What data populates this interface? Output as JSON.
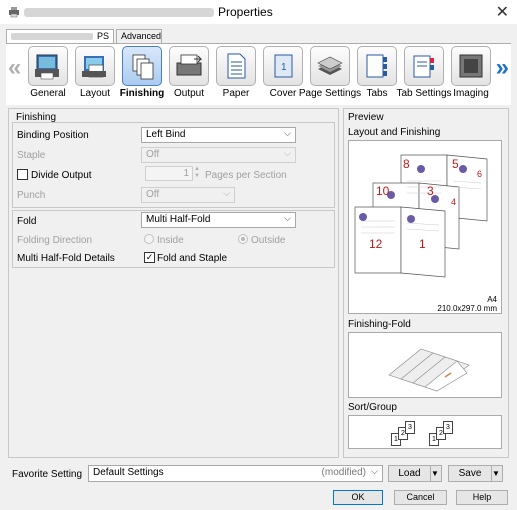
{
  "window": {
    "title": "Properties"
  },
  "tabs": [
    {
      "label": "PS"
    },
    {
      "label": "Advanced"
    }
  ],
  "toolbar": {
    "items": [
      {
        "label": "General",
        "icon": "general-icon"
      },
      {
        "label": "Layout",
        "icon": "layout-icon"
      },
      {
        "label": "Finishing",
        "icon": "finishing-icon",
        "active": true
      },
      {
        "label": "Output",
        "icon": "output-icon"
      },
      {
        "label": "Paper",
        "icon": "paper-icon"
      },
      {
        "label": "Cover",
        "icon": "cover-icon"
      },
      {
        "label": "Page Settings",
        "icon": "page-settings-icon"
      },
      {
        "label": "Tabs",
        "icon": "tabs-icon"
      },
      {
        "label": "Tab Settings",
        "icon": "tab-settings-icon"
      },
      {
        "label": "Imaging",
        "icon": "imaging-icon"
      }
    ]
  },
  "finishing": {
    "group_title": "Finishing",
    "binding_position": {
      "label": "Binding Position",
      "value": "Left Bind"
    },
    "staple": {
      "label": "Staple",
      "value": "Off"
    },
    "divide_output": {
      "label": "Divide Output",
      "checked": false,
      "value": "1",
      "unit": "Pages per Section"
    },
    "punch": {
      "label": "Punch",
      "value": "Off"
    }
  },
  "fold": {
    "fold": {
      "label": "Fold",
      "value": "Multi Half-Fold"
    },
    "folding_direction": {
      "label": "Folding Direction",
      "inside": "Inside",
      "outside": "Outside",
      "selected": "Outside"
    },
    "details": {
      "label": "Multi Half-Fold Details",
      "checkbox_label": "Fold and Staple",
      "checked": true
    }
  },
  "preview": {
    "title": "Preview",
    "layout_title": "Layout and Finishing",
    "page_numbers": [
      "8",
      "5",
      "6",
      "10",
      "3",
      "4",
      "12",
      "1"
    ],
    "paper_size": "A4",
    "paper_dims": "210.0x297.0 mm",
    "fold_title": "Finishing-Fold",
    "sort_title": "Sort/Group",
    "sort_numbers": [
      "1",
      "2",
      "3",
      "1",
      "2",
      "3"
    ]
  },
  "favorite": {
    "label": "Favorite Setting",
    "value": "Default Settings",
    "status": "(modified)",
    "load_label": "Load",
    "save_label": "Save"
  },
  "buttons": {
    "ok": "OK",
    "cancel": "Cancel",
    "help": "Help"
  },
  "colors": {
    "accent": "#1e70c8",
    "page_number": "#c01818",
    "active_icon_bg": "#c3dbf6"
  }
}
